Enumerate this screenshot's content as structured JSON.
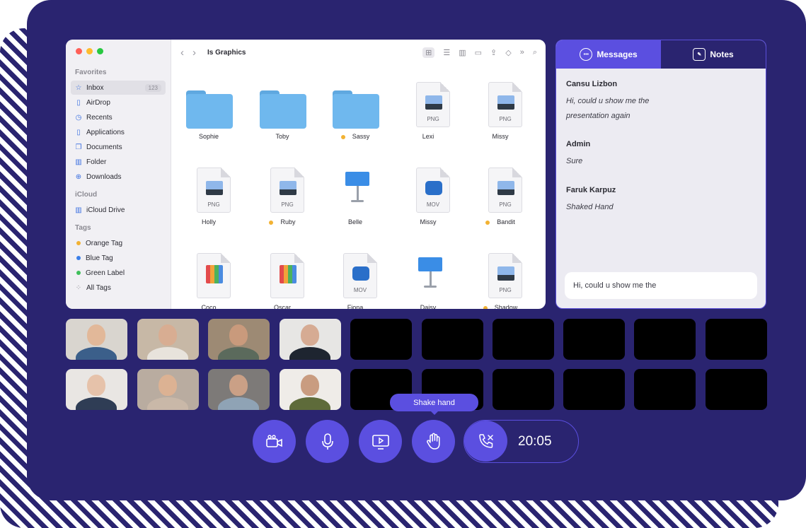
{
  "finder": {
    "window_title": "Is Graphics",
    "sidebar": {
      "favorites_heading": "Favorites",
      "favorites": [
        {
          "label": "Inbox",
          "badge": "123",
          "icon": "star-icon"
        },
        {
          "label": "AirDrop",
          "icon": "document-icon"
        },
        {
          "label": "Recents",
          "icon": "clock-icon"
        },
        {
          "label": "Applications",
          "icon": "document-icon"
        },
        {
          "label": "Documents",
          "icon": "documents-icon"
        },
        {
          "label": "Folder",
          "icon": "folder-icon"
        },
        {
          "label": "Downloads",
          "icon": "download-icon"
        }
      ],
      "icloud_heading": "iCloud",
      "icloud": [
        {
          "label": "iCloud Drive",
          "icon": "folder-icon"
        }
      ],
      "tags_heading": "Tags",
      "tags": [
        {
          "label": "Orange Tag",
          "color": "#f2b233"
        },
        {
          "label": "Blue Tag",
          "color": "#3b7fe8"
        },
        {
          "label": "Green Label",
          "color": "#3fbf5a"
        },
        {
          "label": "All Tags",
          "icon": "all-tags-icon"
        }
      ]
    },
    "files": [
      {
        "name": "Sophie",
        "kind": "folder",
        "tagged": false
      },
      {
        "name": "Toby",
        "kind": "folder",
        "tagged": false
      },
      {
        "name": "Sassy",
        "kind": "folder",
        "tagged": true
      },
      {
        "name": "Lexi",
        "kind": "doc",
        "ext": "PNG",
        "tagged": false
      },
      {
        "name": "Missy",
        "kind": "doc",
        "ext": "PNG",
        "tagged": false
      },
      {
        "name": "Holly",
        "kind": "doc",
        "ext": "PNG",
        "tagged": false
      },
      {
        "name": "Ruby",
        "kind": "doc",
        "ext": "PNG",
        "tagged": true
      },
      {
        "name": "Belle",
        "kind": "keynote",
        "tagged": false
      },
      {
        "name": "Missy",
        "kind": "doc",
        "ext": "MOV",
        "tagged": false
      },
      {
        "name": "Bandit",
        "kind": "doc",
        "ext": "PNG",
        "tagged": true
      },
      {
        "name": "Coco",
        "kind": "chart",
        "tagged": false
      },
      {
        "name": "Oscar",
        "kind": "chart",
        "tagged": false
      },
      {
        "name": "Fiona",
        "kind": "doc",
        "ext": "MOV",
        "tagged": false
      },
      {
        "name": "Daisy",
        "kind": "keynote",
        "tagged": false
      },
      {
        "name": "Shadow",
        "kind": "doc",
        "ext": "PNG",
        "tagged": true
      }
    ]
  },
  "chat": {
    "tabs": [
      {
        "label": "Messages",
        "icon": "chat-bubble-icon",
        "active": true
      },
      {
        "label": "Notes",
        "icon": "pencil-icon",
        "active": false
      }
    ],
    "messages": [
      {
        "author": "Cansu Lizbon",
        "text": "Hi, could u show me the presentation again"
      },
      {
        "author": "Admin",
        "text": "Sure"
      },
      {
        "author": "Faruk Karpuz",
        "text": "Shaked Hand"
      }
    ],
    "input_value": "Hi, could u show me the"
  },
  "controls": {
    "tooltip": "Shake hand",
    "buttons": [
      {
        "name": "camera",
        "icon": "video-camera-icon"
      },
      {
        "name": "microphone",
        "icon": "microphone-icon"
      },
      {
        "name": "screen-share",
        "icon": "screen-share-icon"
      },
      {
        "name": "shake-hand",
        "icon": "hand-icon"
      }
    ],
    "end_call_icon": "end-call-icon",
    "timer": "20:05"
  },
  "colors": {
    "background": "#2a2470",
    "accent": "#5b4fe0",
    "tag_orange": "#f2b233"
  }
}
